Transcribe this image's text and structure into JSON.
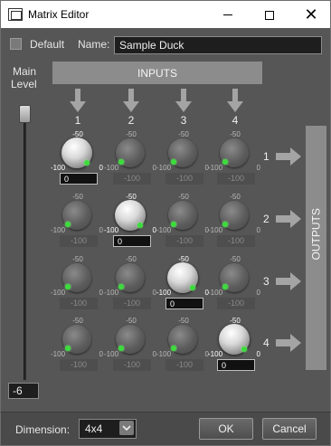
{
  "window": {
    "title": "Matrix Editor"
  },
  "header": {
    "default_label": "Default",
    "name_label": "Name:",
    "name_value": "Sample Duck"
  },
  "main_level": {
    "label_line1": "Main",
    "label_line2": "Level",
    "value": "-6",
    "level_db": -6
  },
  "inputs": {
    "title": "INPUTS",
    "columns": [
      "1",
      "2",
      "3",
      "4"
    ]
  },
  "outputs": {
    "title": "OUTPUTS",
    "rows": [
      "1",
      "2",
      "3",
      "4"
    ]
  },
  "knob_scale": {
    "min": "-100",
    "mid": "-50",
    "max": "0"
  },
  "matrix": [
    [
      "0",
      "-100",
      "-100",
      "-100"
    ],
    [
      "-100",
      "0",
      "-100",
      "-100"
    ],
    [
      "-100",
      "-100",
      "0",
      "-100"
    ],
    [
      "-100",
      "-100",
      "-100",
      "0"
    ]
  ],
  "footer": {
    "dimension_label": "Dimension:",
    "dimension_value": "4x4",
    "ok_label": "OK",
    "cancel_label": "Cancel"
  },
  "colors": {
    "panel": "#565656",
    "header_bar": "#8c8c8c",
    "led": "#3ddc3d"
  },
  "icons": {
    "app": "matrix-app-icon",
    "minimize": "minimize-icon",
    "maximize": "maximize-icon",
    "close": "close-icon",
    "chevron": "chevron-down-icon"
  }
}
